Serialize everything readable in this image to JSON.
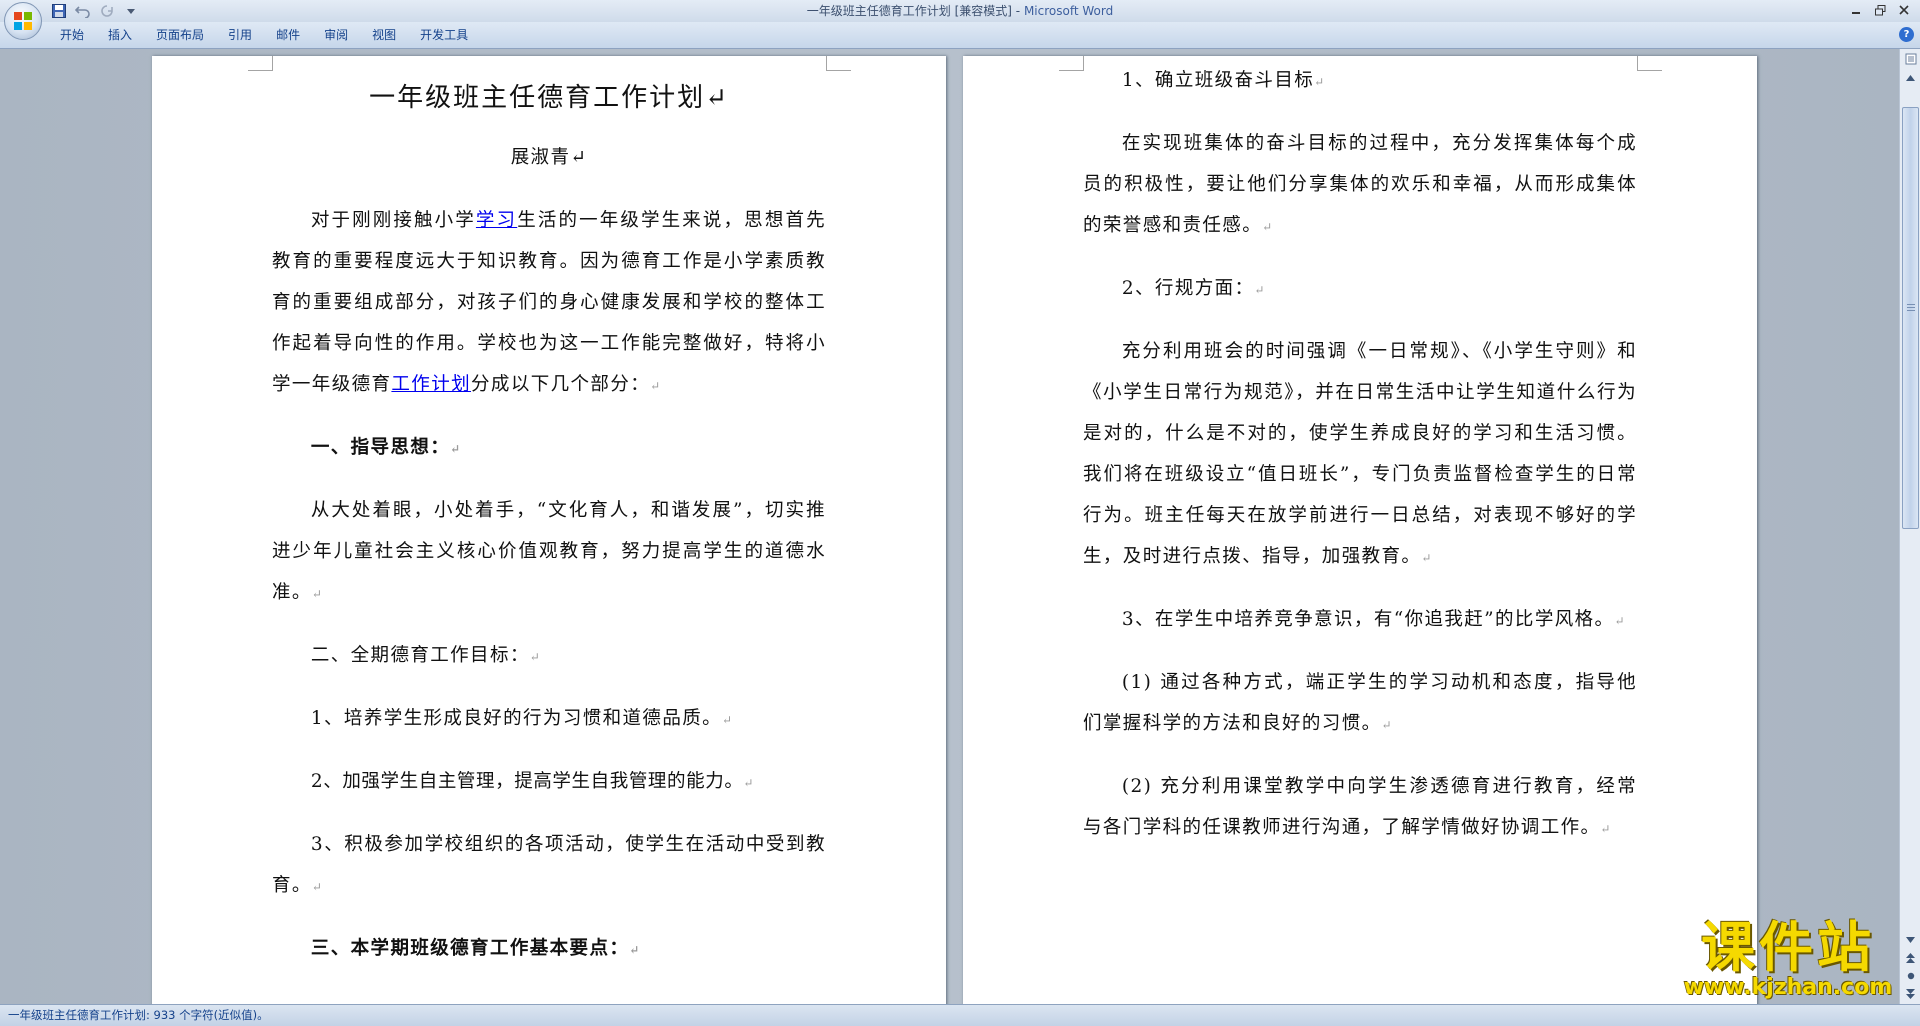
{
  "window": {
    "title": "一年级班主任德育工作计划 [兼容模式]",
    "separator": " - ",
    "app_name": "Microsoft Word"
  },
  "ribbon": {
    "tabs": [
      "开始",
      "插入",
      "页面布局",
      "引用",
      "邮件",
      "审阅",
      "视图",
      "开发工具"
    ]
  },
  "document": {
    "left_page": {
      "title": "一年级班主任德育工作计划",
      "author": "展淑青",
      "intro": {
        "part1": "对于刚刚接触小学",
        "link1": "学习",
        "part2": "生活的一年级学生来说，思想首先教育的重要程度远大于知识教育。因为德育工作是小学素质教育的重要组成部分，对孩子们的身心健康发展和学校的整体工作起着导向性的作用。学校也为这一工作能完整做好，特将小学一年级德育",
        "link2": "工作计划",
        "part3": "分成以下几个部分："
      },
      "h1": "一、指导思想：",
      "p1": "从大处着眼，小处着手，“文化育人，和谐发展”，切实推进少年儿童社会主义核心价值观教育，努力提高学生的道德水准。",
      "h2": "二、全期德育工作目标：",
      "g1": "1、培养学生形成良好的行为习惯和道德品质。",
      "g2": "2、加强学生自主管理，提高学生自我管理的能力。",
      "g3": "3、积极参加学校组织的各项活动，使学生在活动中受到教育。",
      "h3": "三、本学期班级德育工作基本要点："
    },
    "right_page": {
      "r1": "1、确立班级奋斗目标",
      "r2": "在实现班集体的奋斗目标的过程中，充分发挥集体每个成员的积极性，要让他们分享集体的欢乐和幸福，从而形成集体的荣誉感和责任感。",
      "r3": "2、行规方面：",
      "r4": "充分利用班会的时间强调《一日常规》、《小学生守则》和《小学生日常行为规范》，并在日常生活中让学生知道什么行为是对的，什么是不对的，使学生养成良好的学习和生活习惯。我们将在班级设立“值日班长”，专门负责监督检查学生的日常行为。班主任每天在放学前进行一日总结，对表现不够好的学生，及时进行点拨、指导，加强教育。",
      "r5": "3、在学生中培养竞争意识，有“你追我赶”的比学风格。",
      "r6": "(1) 通过各种方式，端正学生的学习动机和态度，指导他们掌握科学的方法和良好的习惯。",
      "r7": "(2) 充分利用课堂教学中向学生渗透德育进行教育，经常与各门学科的任课教师进行沟通，了解学情做好协调工作。"
    }
  },
  "status_bar": {
    "text": "一年级班主任德育工作计划: 933 个字符(近似值)。"
  },
  "watermark": {
    "chinese": "课件站",
    "url": "www.kjzhan.com"
  },
  "icons": {
    "paragraph_mark": "↵",
    "office_button": "office-logo-icon",
    "save": "save-icon",
    "undo": "undo-icon",
    "redo": "redo-icon",
    "customize": "qat-customize-icon",
    "minimize": "minimize-icon",
    "restore": "restore-icon",
    "close": "close-icon",
    "help": "help-icon"
  },
  "colors": {
    "link": "#0000ee",
    "ribbon_text": "#15428b",
    "watermark": "#f5d900"
  }
}
